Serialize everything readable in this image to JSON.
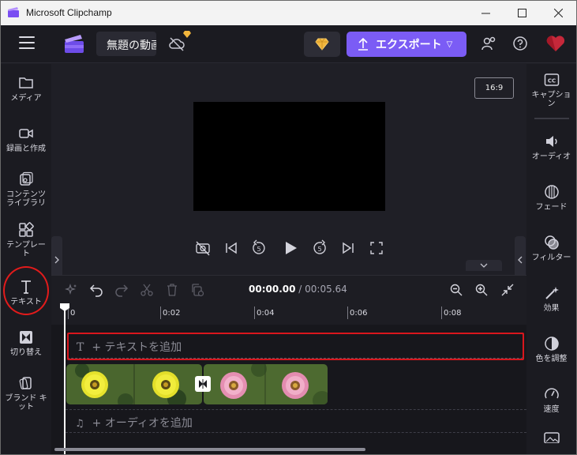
{
  "window": {
    "title": "Microsoft Clipchamp",
    "controls": [
      "minimize",
      "maximize",
      "close"
    ]
  },
  "topbar": {
    "project_name": "無題の動画",
    "export_label": "エクスポート",
    "icons": [
      "menu-icon",
      "clipchamp-logo",
      "cloud-off-icon",
      "premium-gem-icon",
      "share-icon",
      "help-icon",
      "heart-icon"
    ]
  },
  "left_nav": {
    "items": [
      {
        "label": "メディア",
        "icon": "folder-icon"
      },
      {
        "label": "録画と作成",
        "icon": "camera-icon"
      },
      {
        "label": "コンテンツライブラリ",
        "icon": "library-icon"
      },
      {
        "label": "テンプレート",
        "icon": "template-icon"
      },
      {
        "label": "テキスト",
        "icon": "text-icon"
      },
      {
        "label": "切り替え",
        "icon": "transition-icon"
      },
      {
        "label": "ブランド キット",
        "icon": "brand-kit-icon"
      }
    ]
  },
  "right_nav": {
    "items": [
      {
        "label": "キャプション",
        "icon": "captions-icon"
      },
      {
        "label": "オーディオ",
        "icon": "audio-icon"
      },
      {
        "label": "フェード",
        "icon": "fade-icon"
      },
      {
        "label": "フィルター",
        "icon": "filter-icon"
      },
      {
        "label": "効果",
        "icon": "effects-icon"
      },
      {
        "label": "色を調整",
        "icon": "color-adjust-icon"
      },
      {
        "label": "速度",
        "icon": "speed-icon"
      }
    ]
  },
  "preview": {
    "aspect_ratio": "16:9"
  },
  "timeline": {
    "current_time": "00:00.00",
    "separator": " / ",
    "total_time": "00:05.64",
    "ruler_ticks": [
      "0",
      "0:02",
      "0:04",
      "0:06",
      "0:08"
    ],
    "text_track_label": "+ テキストを追加",
    "text_track_icon": "T",
    "audio_track_label": "+ オーディオを追加",
    "audio_track_icon": "♫"
  },
  "colors": {
    "accent": "#7b5cf5",
    "highlight_red": "#e21b1b",
    "background": "#1e1e25"
  }
}
